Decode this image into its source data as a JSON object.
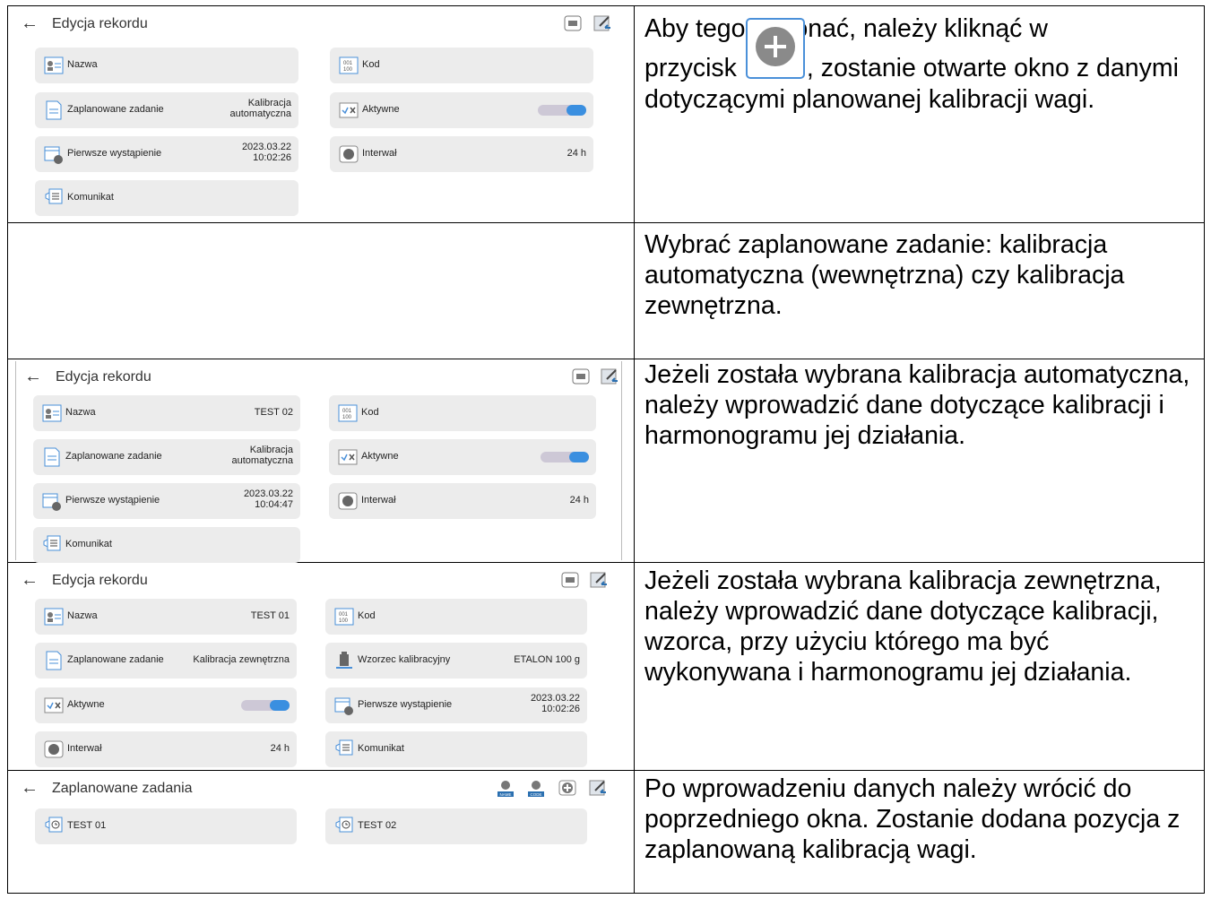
{
  "rows": [
    {
      "screen": {
        "title": "Edycja rekordu",
        "tiles": [
          {
            "label": "Nazwa",
            "value": "",
            "icon": "name-icon"
          },
          {
            "label": "Kod",
            "value": "",
            "icon": "code-icon"
          },
          {
            "label": "Zaplanowane zadanie",
            "value": "Kalibracja\nautomatyczna",
            "value1": "Kalibracja",
            "value2": "automatyczna",
            "icon": "document-icon"
          },
          {
            "label": "Aktywne",
            "value": "",
            "icon": "checkbox-icon"
          },
          {
            "label": "Pierwsze wystąpienie",
            "value1": "2023.03.22",
            "value2": "10:02:26",
            "icon": "calendar-clock-icon"
          },
          {
            "label": "Interwał",
            "value": "24 h",
            "icon": "clock-icon"
          },
          {
            "label": "Komunikat",
            "value": "",
            "icon": "message-icon"
          }
        ]
      },
      "text_before": "Aby tego dokonać, należy kliknąć w",
      "text_mid": "przycisk",
      "text_after": ", zostanie otwarte okno z danymi dotyczącymi planowanej kalibracji wagi."
    },
    {
      "text": "Wybrać zaplanowane zadanie: kalibracja automatyczna (wewnętrzna) czy kalibracja zewnętrzna."
    },
    {
      "screen": {
        "title": "Edycja rekordu",
        "tiles": [
          {
            "label": "Nazwa",
            "value": "TEST 02"
          },
          {
            "label": "Kod",
            "value": ""
          },
          {
            "label": "Zaplanowane zadanie",
            "value1": "Kalibracja",
            "value2": "automatyczna"
          },
          {
            "label": "Aktywne"
          },
          {
            "label": "Pierwsze wystąpienie",
            "value1": "2023.03.22",
            "value2": "10:04:47"
          },
          {
            "label": "Interwał",
            "value": "24 h"
          },
          {
            "label": "Komunikat"
          }
        ]
      },
      "text": "Jeżeli została wybrana kalibracja automatyczna, należy wprowadzić dane dotyczące kalibracji i harmonogramu jej działania."
    },
    {
      "screen": {
        "title": "Edycja rekordu",
        "tiles": [
          {
            "label": "Nazwa",
            "value": "TEST 01"
          },
          {
            "label": "Kod",
            "value": ""
          },
          {
            "label": "Zaplanowane zadanie",
            "value": "Kalibracja zewnętrzna"
          },
          {
            "label": "Wzorzec kalibracyjny",
            "value": "ETALON 100 g"
          },
          {
            "label": "Aktywne"
          },
          {
            "label": "Pierwsze wystąpienie",
            "value1": "2023.03.22",
            "value2": "10:02:26"
          },
          {
            "label": "Interwał",
            "value": "24 h"
          },
          {
            "label": "Komunikat"
          }
        ]
      },
      "text": "Jeżeli została wybrana kalibracja zewnętrzna, należy wprowadzić dane dotyczące kalibracji, wzorca, przy użyciu którego ma być wykonywana i harmonogramu jej działania."
    },
    {
      "screen": {
        "title": "Zaplanowane zadania",
        "items": [
          "TEST 01",
          "TEST 02"
        ],
        "icon_badges": [
          "NAME",
          "CODE"
        ]
      },
      "text": "Po wprowadzeniu danych należy wrócić do poprzedniego okna. Zostanie dodana pozycja z zaplanowaną kalibracją wagi."
    }
  ],
  "colors": {
    "tile_bg": "#ececec",
    "toggle_on": "#3a8fe0",
    "plus_button": "#4a90d9"
  }
}
